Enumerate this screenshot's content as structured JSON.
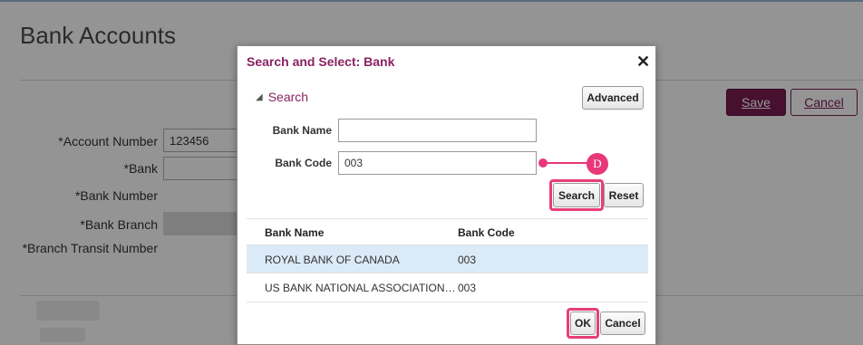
{
  "page": {
    "title": "Bank Accounts",
    "save_label": "Save",
    "cancel_label": "Cancel",
    "labels": {
      "account_number": "*Account Number",
      "bank": "*Bank",
      "bank_number": "*Bank Number",
      "bank_branch": "*Bank Branch",
      "branch_transit_number": "*Branch Transit Number"
    },
    "account_number_value": "123456"
  },
  "dialog": {
    "title": "Search and Select: Bank",
    "close_glyph": "✕",
    "search_header": "Search",
    "toggle_glyph": "◢",
    "advanced_label": "Advanced",
    "bank_name_label": "Bank Name",
    "bank_name_value": "",
    "bank_code_label": "Bank Code",
    "bank_code_value": "003",
    "search_label": "Search",
    "reset_label": "Reset",
    "callout_letter": "D",
    "columns": [
      "Bank Name",
      "Bank Code"
    ],
    "rows": [
      {
        "name": "ROYAL BANK OF CANADA",
        "code": "003",
        "selected": true
      },
      {
        "name": "US BANK NATIONAL ASSOCIATION…",
        "code": "003",
        "selected": false
      }
    ],
    "ok_label": "OK",
    "cancel_label": "Cancel"
  },
  "colors": {
    "accent": "#8a2262",
    "save_button": "#7b1d52",
    "highlight": "#e83e78",
    "selected_row": "#dbeaf7"
  }
}
